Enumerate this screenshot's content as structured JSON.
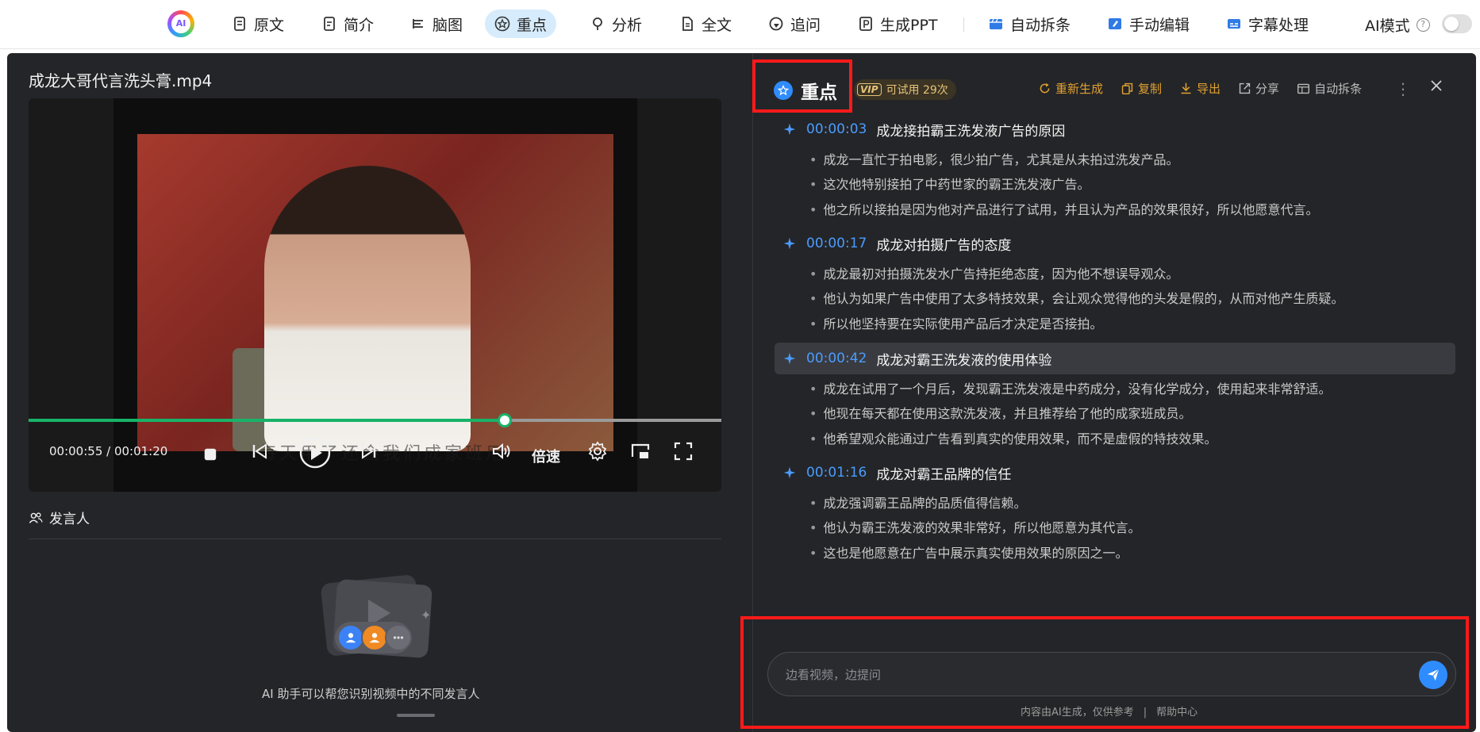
{
  "topnav": {
    "logo_text": "AI",
    "tabs": [
      {
        "label": "原文",
        "icon": "document-icon"
      },
      {
        "label": "简介",
        "icon": "summary-icon"
      },
      {
        "label": "脑图",
        "icon": "mindmap-icon"
      },
      {
        "label": "重点",
        "icon": "star-icon",
        "active": true
      },
      {
        "label": "分析",
        "icon": "bulb-icon"
      },
      {
        "label": "全文",
        "icon": "fulltext-icon"
      },
      {
        "label": "追问",
        "icon": "chat-icon"
      },
      {
        "label": "生成PPT",
        "icon": "ppt-icon"
      },
      {
        "label": "自动拆条",
        "icon": "clip-icon"
      },
      {
        "label": "手动编辑",
        "icon": "edit-icon"
      },
      {
        "label": "字幕处理",
        "icon": "subtitle-icon"
      }
    ],
    "ai_mode_label": "AI模式",
    "ai_mode_on": false
  },
  "video": {
    "title": "成龙大哥代言洗头膏.mp4",
    "current_time": "00:00:55",
    "duration": "00:01:20",
    "time_display": "00:00:55 / 00:01:20",
    "progress": 0.6875,
    "burned_subtitle": "每天用了还会我们成家班用",
    "speed_label": "倍速"
  },
  "speakers": {
    "heading": "发言人",
    "empty_text": "AI 助手可以帮您识别视频中的不同发言人"
  },
  "panel": {
    "title": "重点",
    "vip_badge": "VIP",
    "trial_text": "可试用 29次",
    "actions": [
      {
        "label": "重新生成",
        "icon": "refresh-icon"
      },
      {
        "label": "复制",
        "icon": "copy-icon"
      },
      {
        "label": "导出",
        "icon": "download-icon"
      },
      {
        "label": "分享",
        "icon": "share-icon"
      },
      {
        "label": "自动拆条",
        "icon": "clip-icon"
      }
    ],
    "sections": [
      {
        "timestamp": "00:00:03",
        "heading": "成龙接拍霸王洗发液广告的原因",
        "bullets": [
          "成龙一直忙于拍电影，很少拍广告，尤其是从未拍过洗发产品。",
          "这次他特别接拍了中药世家的霸王洗发液广告。",
          "他之所以接拍是因为他对产品进行了试用，并且认为产品的效果很好，所以他愿意代言。"
        ]
      },
      {
        "timestamp": "00:00:17",
        "heading": "成龙对拍摄广告的态度",
        "bullets": [
          "成龙最初对拍摄洗发水广告持拒绝态度，因为他不想误导观众。",
          "他认为如果广告中使用了太多特技效果，会让观众觉得他的头发是假的，从而对他产生质疑。",
          "所以他坚持要在实际使用产品后才决定是否接拍。"
        ]
      },
      {
        "timestamp": "00:00:42",
        "heading": "成龙对霸王洗发液的使用体验",
        "highlighted": true,
        "bullets": [
          "成龙在试用了一个月后，发现霸王洗发液是中药成分，没有化学成分，使用起来非常舒适。",
          "他现在每天都在使用这款洗发液，并且推荐给了他的成家班成员。",
          "他希望观众能通过广告看到真实的使用效果，而不是虚假的特技效果。"
        ]
      },
      {
        "timestamp": "00:01:16",
        "heading": "成龙对霸王品牌的信任",
        "bullets": [
          "成龙强调霸王品牌的品质值得信赖。",
          "他认为霸王洗发液的效果非常好，所以他愿意为其代言。",
          "这也是他愿意在广告中展示真实使用效果的原因之一。"
        ]
      }
    ],
    "chat_placeholder": "边看视频，边提问",
    "disclaimer": "内容由AI生成，仅供参考",
    "help_link": "帮助中心"
  },
  "colors": {
    "accent": "#2f8cff",
    "progress": "#18b368",
    "action": "#e0a030",
    "annotation": "#ff1a1a"
  }
}
